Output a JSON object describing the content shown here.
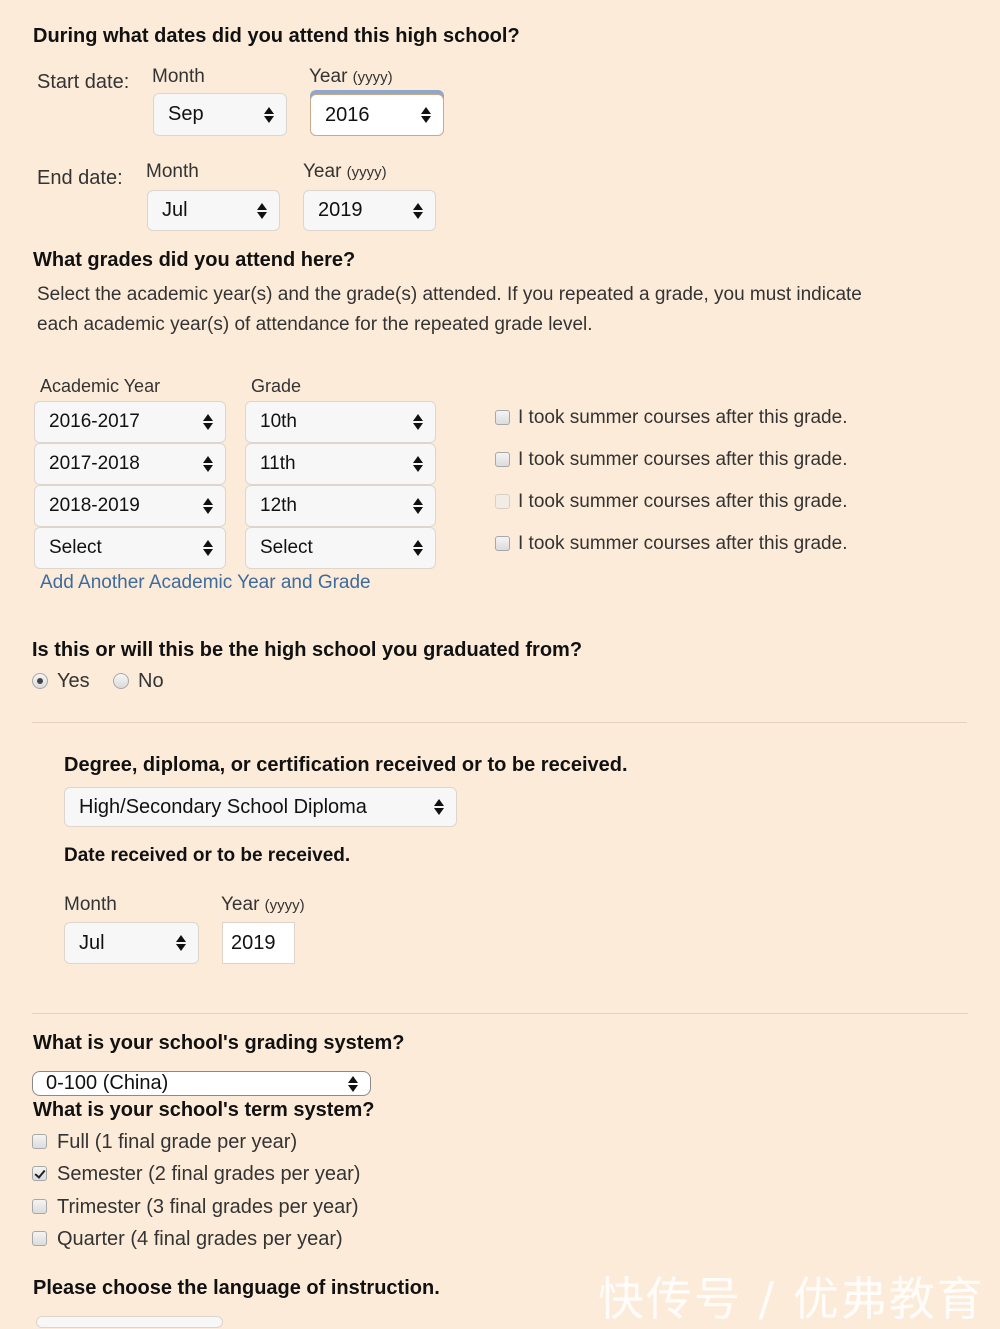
{
  "dates": {
    "heading": "During what dates did you attend this high school?",
    "start": {
      "label": "Start date:",
      "month_label": "Month",
      "year_label": "Year",
      "year_hint": "(yyyy)",
      "month": "Sep",
      "year": "2016"
    },
    "end": {
      "label": "End date:",
      "month_label": "Month",
      "year_label": "Year",
      "year_hint": "(yyyy)",
      "month": "Jul",
      "year": "2019"
    }
  },
  "grades": {
    "heading": "What grades did you attend here?",
    "description_line1": "Select the academic year(s) and the grade(s) attended. If you repeated a grade, you must indicate",
    "description_line2": "each academic year(s) of attendance for the repeated grade level.",
    "col_year": "Academic Year",
    "col_grade": "Grade",
    "rows": [
      {
        "year": "2016-2017",
        "grade": "10th",
        "summer": "I took summer courses after this grade.",
        "checked": false,
        "enabled": true
      },
      {
        "year": "2017-2018",
        "grade": "11th",
        "summer": "I took summer courses after this grade.",
        "checked": false,
        "enabled": true
      },
      {
        "year": "2018-2019",
        "grade": "12th",
        "summer": "I took summer courses after this grade.",
        "checked": false,
        "enabled": false
      },
      {
        "year": "Select",
        "grade": "Select",
        "summer": "I took summer courses after this grade.",
        "checked": false,
        "enabled": true
      }
    ],
    "add_link": "Add Another Academic Year and Grade"
  },
  "graduated": {
    "heading": "Is this or will this be the high school you graduated from?",
    "options": [
      {
        "label": "Yes",
        "selected": true
      },
      {
        "label": "No",
        "selected": false
      }
    ]
  },
  "degree": {
    "heading": "Degree, diploma, or certification received or to be received.",
    "value": "High/Secondary School Diploma",
    "date_heading": "Date received or to be received.",
    "month_label": "Month",
    "year_label": "Year",
    "year_hint": "(yyyy)",
    "month": "Jul",
    "year": "2019"
  },
  "grading": {
    "heading": "What is your school's grading system?",
    "value": "0-100 (China)"
  },
  "term": {
    "heading": "What is your school's term system?",
    "options": [
      {
        "label": "Full (1 final grade per year)",
        "checked": false
      },
      {
        "label": "Semester (2 final grades per year)",
        "checked": true
      },
      {
        "label": "Trimester (3 final grades per year)",
        "checked": false
      },
      {
        "label": "Quarter (4 final grades per year)",
        "checked": false
      }
    ]
  },
  "language": {
    "heading": "Please choose the language of instruction."
  },
  "watermark": "快传号 / 优弗教育"
}
